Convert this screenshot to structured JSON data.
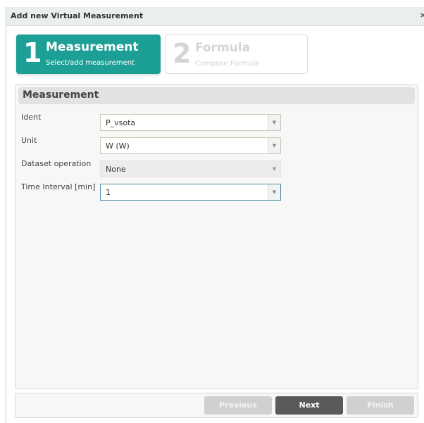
{
  "dialog": {
    "title": "Add new Virtual Measurement",
    "close_glyph": "×"
  },
  "wizard": {
    "steps": [
      {
        "number": "1",
        "name": "Measurement",
        "subtitle": "Select/add measurement",
        "active": true
      },
      {
        "number": "2",
        "name": "Formula",
        "subtitle": "Compose Formula",
        "active": false
      }
    ]
  },
  "panel": {
    "title": "Measurement",
    "fields": [
      {
        "label": "Ident",
        "value": "P_vsota",
        "state": "enabled"
      },
      {
        "label": "Unit",
        "value": "W (W)",
        "state": "enabled"
      },
      {
        "label": "Dataset operation",
        "value": "None",
        "state": "disabled"
      },
      {
        "label": "Time Interval [min]",
        "value": "1",
        "state": "focused"
      }
    ]
  },
  "footer": {
    "previous_label": "Previous",
    "next_label": "Next",
    "finish_label": "Finish"
  },
  "icons": {
    "dropdown": "chevron-down-icon",
    "close": "close-icon"
  },
  "colors": {
    "accent": "#1c9f95",
    "primary_button": "#5a5a5a",
    "disabled_button": "#d0d0d0"
  }
}
